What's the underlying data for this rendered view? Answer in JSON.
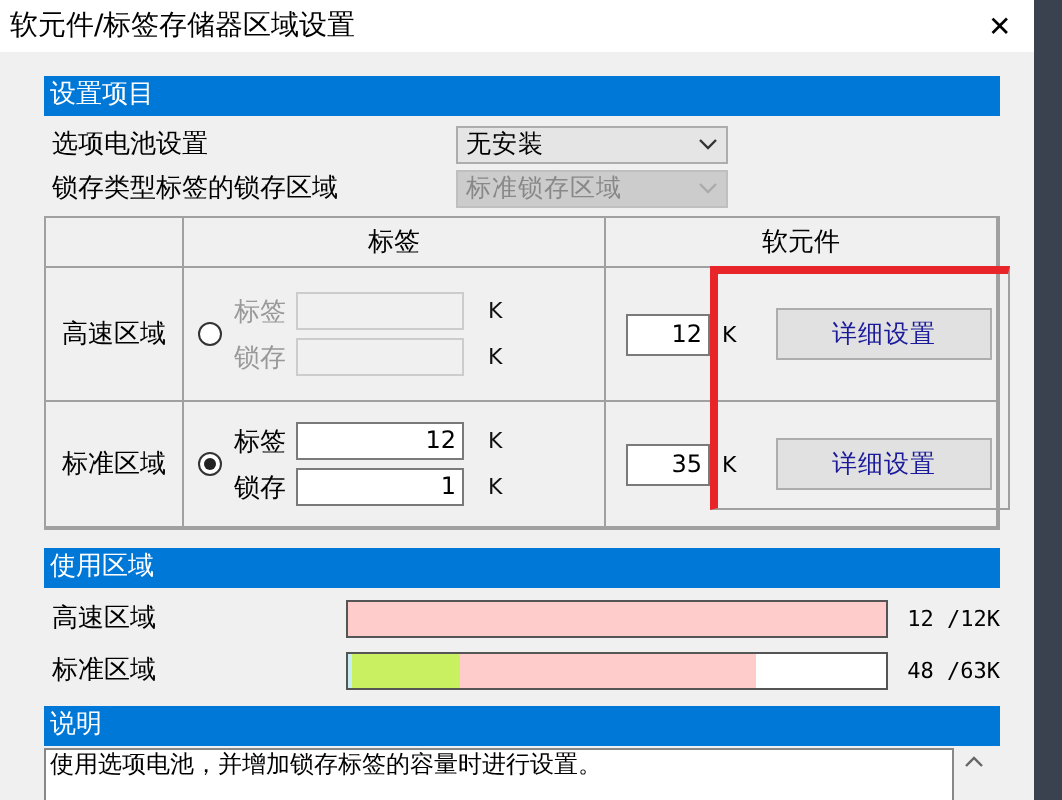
{
  "window": {
    "title": "软元件/标签存储器区域设置",
    "close": "✕"
  },
  "settings": {
    "header": "设置项目",
    "fields": [
      {
        "label": "选项电池设置",
        "value": "无安装",
        "disabled": false
      },
      {
        "label": "锁存类型标签的锁存区域",
        "value": "标准锁存区域",
        "disabled": true
      }
    ]
  },
  "table": {
    "columns": [
      "标签",
      "软元件"
    ],
    "highlight_frame": true,
    "rows": [
      {
        "name": "高速区域",
        "selected": false,
        "inputs": [
          {
            "label": "标签",
            "unit": "K",
            "disabled": true
          },
          {
            "label": "锁存",
            "unit": "K",
            "disabled": true
          }
        ],
        "device": {
          "value": "12",
          "unit": "K"
        },
        "button": "详细设置"
      },
      {
        "name": "标准区域",
        "selected": true,
        "inputs": [
          {
            "label": "标签",
            "value": "12",
            "unit": "K",
            "disabled": false
          },
          {
            "label": "锁存",
            "value": "1",
            "unit": "K",
            "disabled": false
          }
        ],
        "device": {
          "value": "35",
          "unit": "K"
        },
        "button": "详细设置"
      }
    ]
  },
  "usage": {
    "header": "使用区域",
    "rows": [
      {
        "label": "高速区域",
        "reading": "12 /12K",
        "segments": [
          {
            "level": 1,
            "color": "#ffcccc"
          }
        ]
      },
      {
        "label": "标准区域",
        "reading": "48 /63K",
        "segments": [
          {
            "level": 0.76,
            "color": "#ffcccc"
          },
          {
            "level": 0.21,
            "color": "#c8f060"
          },
          {
            "level": 0.01,
            "color": "#c8ecf4"
          }
        ]
      }
    ]
  },
  "description": {
    "header": "说明",
    "lines": [
      "使用选项电池，并增加锁存标签的容量时进行设置。"
    ]
  }
}
